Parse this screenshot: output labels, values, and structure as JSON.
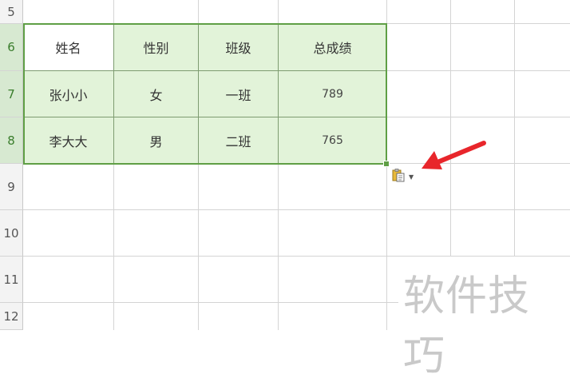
{
  "row_headers": [
    "5",
    "6",
    "7",
    "8",
    "9",
    "10",
    "11",
    "12"
  ],
  "table": {
    "headers": [
      "姓名",
      "性别",
      "班级",
      "总成绩"
    ],
    "rows": [
      [
        "张小小",
        "女",
        "一班",
        "789"
      ],
      [
        "李大大",
        "男",
        "二班",
        "765"
      ]
    ]
  },
  "selection": {
    "fill_color": "#e2f3d9",
    "border_color": "#5f9f45",
    "selected_row_headers": [
      "6",
      "7",
      "8"
    ]
  },
  "paste_options": {
    "icon": "clipboard-paste-icon",
    "dropdown": "caret-down-icon"
  },
  "annotation_arrow": {
    "icon": "red-arrow-icon",
    "color": "#e8262b"
  },
  "watermark": {
    "text": "软件技巧"
  }
}
